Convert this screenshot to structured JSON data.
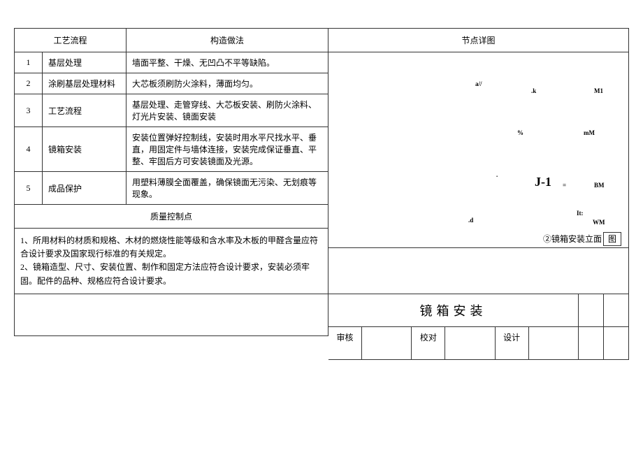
{
  "left": {
    "header_process": "工艺流程",
    "header_method": "构造做法",
    "rows": [
      {
        "num": "1",
        "name": "基层处理",
        "desc": "墙面平整、干燥、无凹凸不平等缺陷。"
      },
      {
        "num": "2",
        "name": "涂刷基层处理材料",
        "desc": "大芯板须刷防火涂料，薄面均匀。"
      },
      {
        "num": "3",
        "name": "工艺流程",
        "desc": "基层处理、走管穿线、大芯板安装、刷防火涂料、灯光片安装、镜面安装"
      },
      {
        "num": "4",
        "name": "镜箱安装",
        "desc": "安装位置弹好控制线，安装时用水平尺找水平、垂直，用固定件与墙体连接，安装完成保证垂直、平整、牢固后方可安装镜面及光源。"
      },
      {
        "num": "5",
        "name": "成品保护",
        "desc": "用塑料薄膜全面覆盖，确保镜面无污染、无划痕等现象。"
      }
    ],
    "qc_header": "质量控制点",
    "qc_items": [
      "1、所用材料的材质和规格、木材的燃烧性能等级和含水率及木板的甲醛含量应符合设计要求及国家现行标准的有关规定。",
      "2、镜箱造型、尺寸、安装位置、制作和固定方法应符合设计要求，安装必须牢固。配件的品种、规格应符合设计要求。"
    ]
  },
  "right": {
    "header_detail": "节点详图",
    "diagram_caption": "②镜箱安装立面",
    "diagram_label_end": "图",
    "labels": {
      "a": "a//",
      "k": ".k",
      "M1": "M1",
      "pct": "%",
      "mM": "mM",
      "J1": "J-1",
      "eq": "=",
      "BM": "BM",
      "dd": ".d",
      "It": "It:",
      "WM": "WM",
      "dot": "."
    }
  },
  "title_block": {
    "title": "镜箱安装",
    "sig1": "审核",
    "sig2": "校对",
    "sig3": "设计"
  }
}
